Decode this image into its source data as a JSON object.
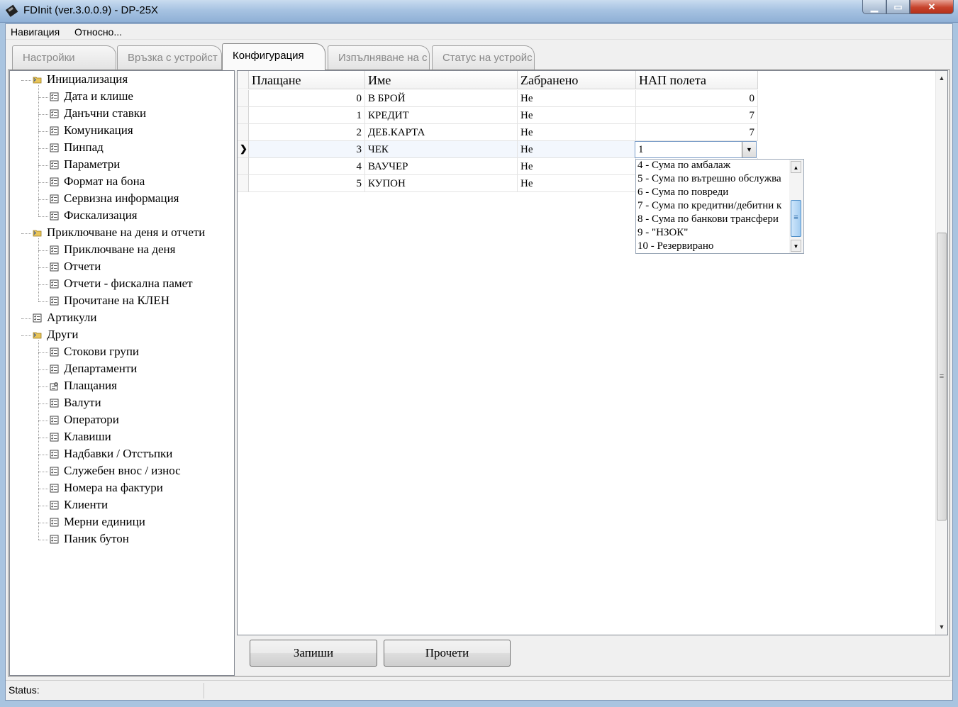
{
  "window": {
    "title": "FDInit (ver.3.0.0.9) - DP-25X",
    "minimize": "▁",
    "maximize": "▭",
    "close": "✕"
  },
  "menu": {
    "items": [
      "Навигация",
      "Относно..."
    ]
  },
  "tabs": [
    {
      "label": "Настройки",
      "active": false
    },
    {
      "label": "Връзка с устройст",
      "active": false
    },
    {
      "label": "Конфигурация",
      "active": true
    },
    {
      "label": "Изпълняване на с",
      "active": false
    },
    {
      "label": "Статус на устройс",
      "active": false
    }
  ],
  "tree": {
    "groups": [
      {
        "label": "Инициализация",
        "icon": "folder-icon",
        "children": [
          "Дата и клише",
          "Данъчни ставки",
          "Комуникация",
          "Пинпад",
          "Параметри",
          "Формат на бона",
          "Сервизна информация",
          "Фискализация"
        ]
      },
      {
        "label": "Приключване на деня и отчети",
        "icon": "folder-icon",
        "children": [
          "Приключване на деня",
          "Отчети",
          "Отчети - фискална памет",
          "Прочитане на КЛЕН"
        ]
      },
      {
        "label": "Артикули",
        "icon": "document-icon",
        "children": []
      },
      {
        "label": "Други",
        "icon": "folder-icon",
        "children": [
          "Стокови групи",
          "Департаменти",
          "Плащания",
          "Валути",
          "Оператори",
          "Клавиши",
          "Надбавки / Отстъпки",
          "Служебен внос / износ",
          "Номера на фактури",
          "Клиенти",
          "Мерни единици",
          "Паник бутон"
        ]
      }
    ],
    "selected_item": "Плащания"
  },
  "grid": {
    "columns": [
      "Плащане",
      "Име",
      "Zабранено",
      "НАП полета"
    ],
    "rows": [
      {
        "payment": "0",
        "name": "В БРОЙ",
        "forbidden": "Не",
        "nap": "0"
      },
      {
        "payment": "1",
        "name": "КРЕДИТ",
        "forbidden": "Не",
        "nap": "7"
      },
      {
        "payment": "2",
        "name": "ДЕБ.КАРТА",
        "forbidden": "Не",
        "nap": "7"
      },
      {
        "payment": "3",
        "name": "ЧЕК",
        "forbidden": "Не",
        "nap": "1"
      },
      {
        "payment": "4",
        "name": "ВАУЧЕР",
        "forbidden": "Не",
        "nap": ""
      },
      {
        "payment": "5",
        "name": "КУПОН",
        "forbidden": "Не",
        "nap": ""
      }
    ],
    "current_row_marker": "❯",
    "scroll_up": "▲",
    "scroll_down": "▼",
    "scroll_grip": "≡"
  },
  "combo": {
    "value": "1",
    "arrow": "▼",
    "options": [
      "4 - Сума по амбалаж",
      "5 - Сума по вътрешно обслужва",
      "6 - Сума по повреди",
      "7 - Сума по кредитни/дебитни к",
      "8 - Сума по банкови трансфери",
      "9 - \"НЗОК\"",
      "10 - Резервирано"
    ],
    "scroll_up": "▲",
    "scroll_down": "▼",
    "scroll_grip": "≡"
  },
  "buttons": {
    "save": "Запиши",
    "read": "Прочети"
  },
  "status": {
    "label": "Status:"
  },
  "colors": {
    "title_gradient_top": "#c9dcef",
    "close_red": "#c7432c",
    "selection_blue": "#4f8fc9"
  }
}
